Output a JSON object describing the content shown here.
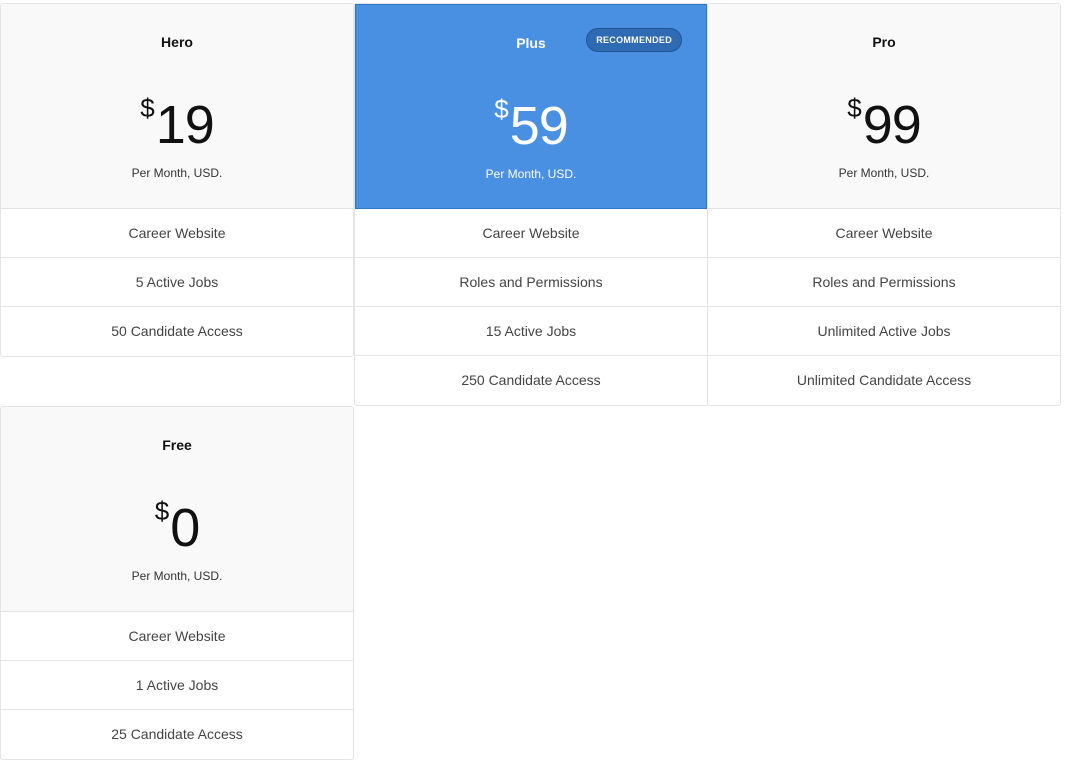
{
  "plans": [
    {
      "name": "Hero",
      "currency": "$",
      "amount": "19",
      "period": "Per Month, USD.",
      "features": [
        "Career Website",
        "5 Active Jobs",
        "50 Candidate Access"
      ]
    },
    {
      "name": "Plus",
      "badge": "RECOMMENDED",
      "currency": "$",
      "amount": "59",
      "period": "Per Month, USD.",
      "features": [
        "Career Website",
        "Roles and Permissions",
        "15 Active Jobs",
        "250 Candidate Access"
      ]
    },
    {
      "name": "Pro",
      "currency": "$",
      "amount": "99",
      "period": "Per Month, USD.",
      "features": [
        "Career Website",
        "Roles and Permissions",
        "Unlimited Active Jobs",
        "Unlimited Candidate Access"
      ]
    },
    {
      "name": "Free",
      "currency": "$",
      "amount": "0",
      "period": "Per Month, USD.",
      "features": [
        "Career Website",
        "1 Active Jobs",
        "25 Candidate Access"
      ]
    }
  ],
  "colors": {
    "accent": "#4a90e2",
    "badge": "#2f6bb3",
    "header_bg": "#f9f9f9",
    "border": "#e4e4e4"
  }
}
